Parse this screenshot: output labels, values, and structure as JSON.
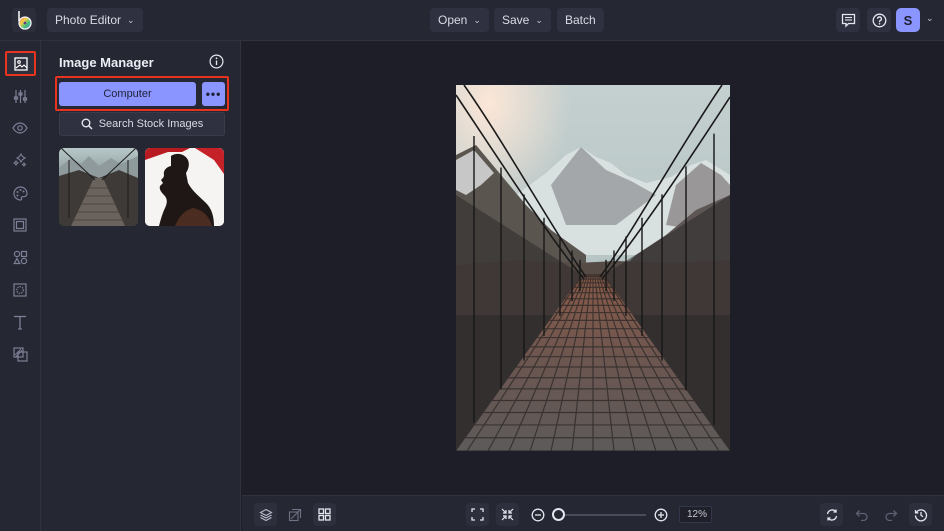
{
  "topbar": {
    "app_switcher_label": "Photo Editor",
    "open_label": "Open",
    "save_label": "Save",
    "batch_label": "Batch",
    "avatar_initial": "S"
  },
  "rail": {
    "items": [
      {
        "name": "image-manager",
        "icon": "image-icon",
        "active": true
      },
      {
        "name": "adjustments",
        "icon": "sliders-icon"
      },
      {
        "name": "touch-up",
        "icon": "eye-icon"
      },
      {
        "name": "effects",
        "icon": "sparkles-icon"
      },
      {
        "name": "artsy",
        "icon": "palette-icon"
      },
      {
        "name": "frames",
        "icon": "frame-icon"
      },
      {
        "name": "graphics",
        "icon": "shapes-icon"
      },
      {
        "name": "textures",
        "icon": "texture-icon"
      },
      {
        "name": "text",
        "icon": "text-icon"
      },
      {
        "name": "overlays",
        "icon": "overlay-icon"
      }
    ]
  },
  "panel": {
    "title": "Image Manager",
    "computer_label": "Computer",
    "more_label": "•••",
    "stock_label": "Search Stock Images",
    "thumbnails": [
      {
        "subject": "suspension bridge with mountains"
      },
      {
        "subject": "silhouette portrait with red fabric"
      }
    ]
  },
  "canvas": {
    "subject": "suspension bridge leading to snowy mountains"
  },
  "bottombar": {
    "zoom_value": "12%",
    "zoom_fraction": 0.0
  },
  "colors": {
    "accent": "#8b95ff",
    "highlight": "#e8331f",
    "panel_bg": "#252733",
    "canvas_bg": "#1d1e27"
  }
}
